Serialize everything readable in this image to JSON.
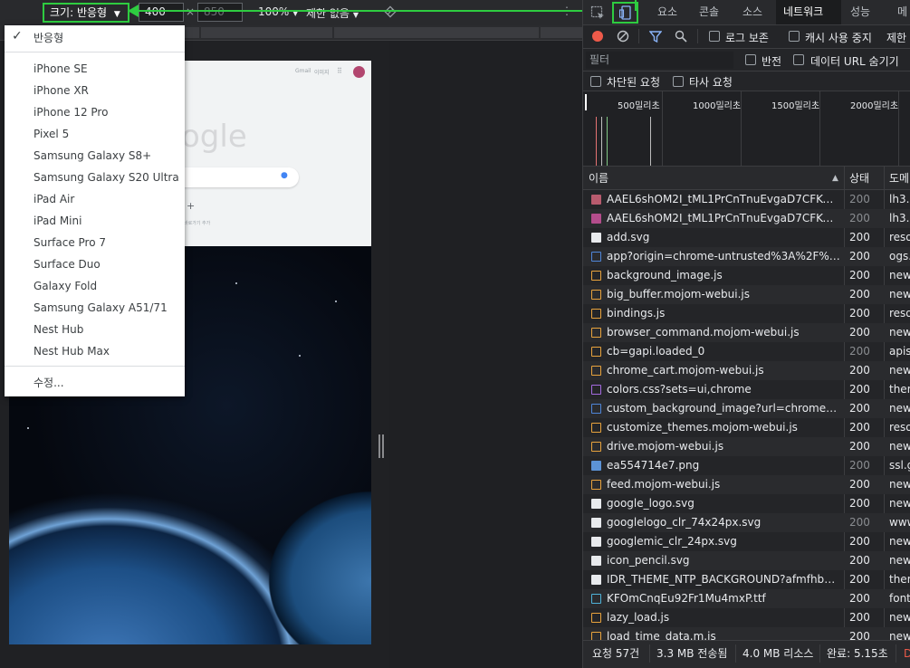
{
  "device_toolbar": {
    "dimensions_label": "크기: 반응형",
    "width_value": "400",
    "height_value": "850",
    "times": "×",
    "zoom": "100%",
    "throttle": "제한 없음"
  },
  "dropdown": {
    "selected": "반응형",
    "devices": [
      "iPhone SE",
      "iPhone XR",
      "iPhone 12 Pro",
      "Pixel 5",
      "Samsung Galaxy S8+",
      "Samsung Galaxy S20 Ultra",
      "iPad Air",
      "iPad Mini",
      "Surface Pro 7",
      "Surface Duo",
      "Galaxy Fold",
      "Samsung Galaxy A51/71",
      "Nest Hub",
      "Nest Hub Max"
    ],
    "edit": "수정..."
  },
  "preview": {
    "logo_text": "ogle",
    "header_links": [
      "Gmail",
      "이미지"
    ],
    "add_symbol": "+",
    "shortcut_label": "바로가기 추가"
  },
  "tabs": [
    "요소",
    "콘솔",
    "소스",
    "네트워크",
    "성능",
    "메"
  ],
  "active_tab": "네트워크",
  "network_toolbar": {
    "preserve_log": "로그 보존",
    "disable_cache": "캐시 사용 중지",
    "throttle": "제한"
  },
  "filter": {
    "placeholder": "필터",
    "invert": "반전",
    "hide_data_urls": "데이터 URL 숨기기"
  },
  "row3": {
    "blocked": "차단된 요청",
    "third_party": "타사 요청"
  },
  "timeline_ticks": [
    "500밀리초",
    "1000밀리초",
    "1500밀리초",
    "2000밀리초"
  ],
  "columns": {
    "name": "이름",
    "status": "상태",
    "domain": "도메"
  },
  "requests": [
    {
      "name": "AAEL6shOM2I_tML1PrCnTnuEvgaD7CFKOsyeM...",
      "status": "200",
      "domain": "lh3.g",
      "icon": "img",
      "dim": true
    },
    {
      "name": "AAEL6shOM2I_tML1PrCnTnuEvgaD7CFKOsyeM...",
      "status": "200",
      "domain": "lh3.g",
      "icon": "img2",
      "dim": true
    },
    {
      "name": "add.svg",
      "status": "200",
      "domain": "reso",
      "icon": "svg",
      "dim": false
    },
    {
      "name": "app?origin=chrome-untrusted%3A%2F%2Fne...",
      "status": "200",
      "domain": "ogs.",
      "icon": "doc",
      "dim": false
    },
    {
      "name": "background_image.js",
      "status": "200",
      "domain": "new-",
      "icon": "js",
      "dim": false
    },
    {
      "name": "big_buffer.mojom-webui.js",
      "status": "200",
      "domain": "new-",
      "icon": "js",
      "dim": false
    },
    {
      "name": "bindings.js",
      "status": "200",
      "domain": "reso",
      "icon": "js",
      "dim": false
    },
    {
      "name": "browser_command.mojom-webui.js",
      "status": "200",
      "domain": "new-",
      "icon": "js",
      "dim": false
    },
    {
      "name": "cb=gapi.loaded_0",
      "status": "200",
      "domain": "apis.",
      "icon": "js",
      "dim": true
    },
    {
      "name": "chrome_cart.mojom-webui.js",
      "status": "200",
      "domain": "new-",
      "icon": "js",
      "dim": false
    },
    {
      "name": "colors.css?sets=ui,chrome",
      "status": "200",
      "domain": "them",
      "icon": "css",
      "dim": false
    },
    {
      "name": "custom_background_image?url=chrome-untru...",
      "status": "200",
      "domain": "new-",
      "icon": "doc",
      "dim": false
    },
    {
      "name": "customize_themes.mojom-webui.js",
      "status": "200",
      "domain": "reso",
      "icon": "js",
      "dim": false
    },
    {
      "name": "drive.mojom-webui.js",
      "status": "200",
      "domain": "new-",
      "icon": "js",
      "dim": false
    },
    {
      "name": "ea554714e7.png",
      "status": "200",
      "domain": "ssl.g",
      "icon": "png",
      "dim": true
    },
    {
      "name": "feed.mojom-webui.js",
      "status": "200",
      "domain": "new-",
      "icon": "js",
      "dim": false
    },
    {
      "name": "google_logo.svg",
      "status": "200",
      "domain": "new-",
      "icon": "svg2",
      "dim": false
    },
    {
      "name": "googlelogo_clr_74x24px.svg",
      "status": "200",
      "domain": "www",
      "icon": "svg2",
      "dim": true
    },
    {
      "name": "googlemic_clr_24px.svg",
      "status": "200",
      "domain": "new-",
      "icon": "svg3",
      "dim": false
    },
    {
      "name": "icon_pencil.svg",
      "status": "200",
      "domain": "new-",
      "icon": "svg4",
      "dim": false
    },
    {
      "name": "IDR_THEME_NTP_BACKGROUND?afmfhbdfjlfmi...",
      "status": "200",
      "domain": "them",
      "icon": "plain",
      "dim": false
    },
    {
      "name": "KFOmCnqEu92Fr1Mu4mxP.ttf",
      "status": "200",
      "domain": "fonts",
      "icon": "font",
      "dim": false
    },
    {
      "name": "lazy_load.js",
      "status": "200",
      "domain": "new-",
      "icon": "js",
      "dim": false
    },
    {
      "name": "load_time_data.m.js",
      "status": "200",
      "domain": "new-",
      "icon": "js",
      "dim": false
    }
  ],
  "statusbar": {
    "requests": "요청 57건",
    "transferred": "3.3 MB 전송됨",
    "resources": "4.0 MB 리소스",
    "finish": "완료: 5.15초",
    "dom": "D"
  },
  "colors": {
    "accent_green": "#2ecc40",
    "devtools_bg": "#242528",
    "record_red": "#ee5a4a",
    "filter_blue": "#8ab4f8"
  }
}
